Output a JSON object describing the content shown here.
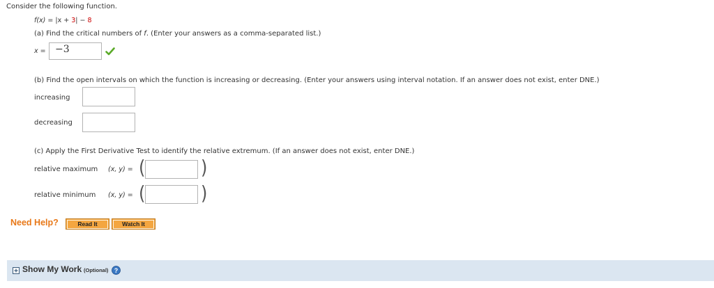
{
  "question": {
    "intro": "Consider the following function.",
    "function": {
      "lhs": "f(x) = ",
      "abs": "|x + ",
      "three": "3",
      "close": "| − ",
      "eight": "8"
    },
    "part_a": {
      "prompt": "(a) Find the critical numbers of ",
      "prompt_f": "f",
      "prompt_tail": ". (Enter your answers as a comma-separated list.)",
      "label": "x =",
      "answer": "−3",
      "status": "correct"
    },
    "part_b": {
      "prompt": "(b) Find the open intervals on which the function is increasing or decreasing. (Enter your answers using interval notation. If an answer does not exist, enter DNE.)",
      "increasing_label": "increasing",
      "decreasing_label": "decreasing",
      "increasing_value": "",
      "decreasing_value": ""
    },
    "part_c": {
      "prompt": "(c) Apply the First Derivative Test to identify the relative extremum. (If an answer does not exist, enter DNE.)",
      "max_label": "relative maximum",
      "min_label": "relative minimum",
      "xy_label": "(x, y) =",
      "max_value": "",
      "min_value": ""
    }
  },
  "help": {
    "label": "Need Help?",
    "read_it": "Read It",
    "watch_it": "Watch It"
  },
  "show_work": {
    "label": "Show My Work",
    "optional": "(Optional)",
    "toggle_icon": "plus-box-icon",
    "help_icon": "question-circle-icon"
  },
  "colors": {
    "accent_red": "#cc0000",
    "check_green": "#5aaa28",
    "help_orange": "#f4a640",
    "help_text": "#e87818",
    "bar_blue": "#dbe6f1"
  }
}
